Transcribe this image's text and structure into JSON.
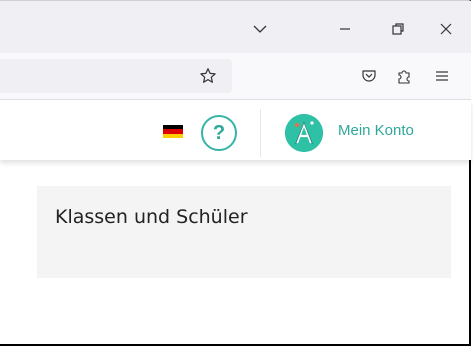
{
  "browser": {
    "titlebar_buttons": {
      "dropdown_icon": "chevron-down",
      "minimize_icon": "minimize",
      "restore_icon": "restore",
      "close_icon": "close"
    },
    "toolbar_icons": [
      "star-bookmark",
      "pocket",
      "extensions",
      "menu"
    ]
  },
  "header": {
    "language_flag": "de",
    "help_label": "?",
    "account_label": "Mein Konto",
    "accent_color": "#2ea89b"
  },
  "main": {
    "card_title": "Klassen und Schüler"
  }
}
